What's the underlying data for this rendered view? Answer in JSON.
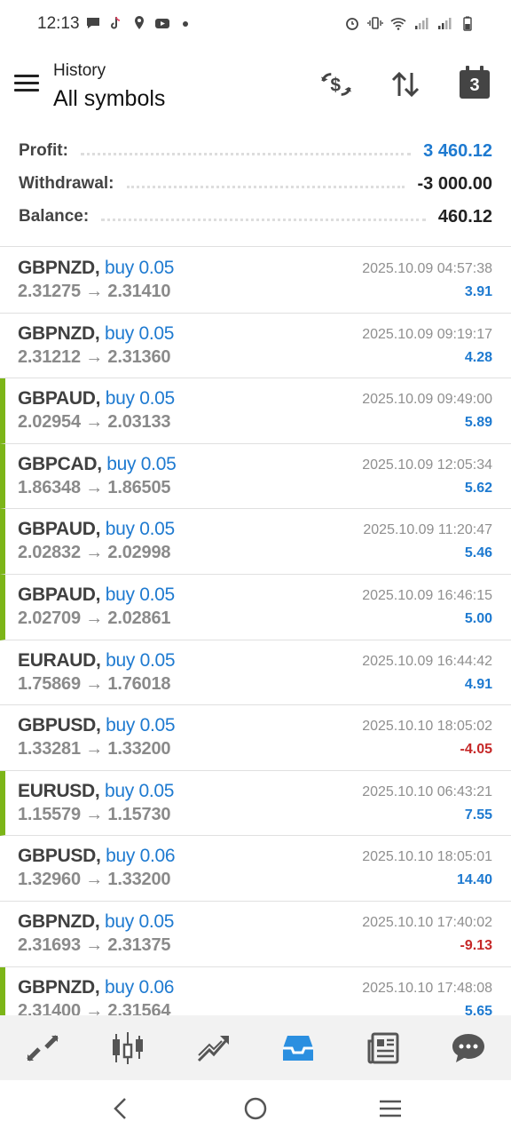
{
  "status_bar": {
    "time": "12:13",
    "left_icons": [
      "message-icon",
      "tiktok-icon",
      "location-icon",
      "youtube-icon",
      "dot-icon"
    ],
    "right_icons": [
      "alarm-icon",
      "vibrate-icon",
      "wifi-icon",
      "signal-icon",
      "signal-icon",
      "battery-icon"
    ]
  },
  "header": {
    "subtitle": "History",
    "title": "All symbols",
    "calendar_badge": "3",
    "actions": [
      "currency-exchange-icon",
      "sort-icon",
      "calendar-icon"
    ]
  },
  "summary": {
    "profit_label": "Profit:",
    "profit_value": "3 460.12",
    "withdrawal_label": "Withdrawal:",
    "withdrawal_value": "-3 000.00",
    "balance_label": "Balance:",
    "balance_value": "460.12"
  },
  "deals": [
    {
      "symbol": "GBPNZD,",
      "side": "buy 0.05",
      "prices": "2.31275 → 2.31410",
      "time": "2025.10.09 04:57:38",
      "pl": "3.91",
      "marked": false,
      "negative": false
    },
    {
      "symbol": "GBPNZD,",
      "side": "buy 0.05",
      "prices": "2.31212 → 2.31360",
      "time": "2025.10.09 09:19:17",
      "pl": "4.28",
      "marked": false,
      "negative": false
    },
    {
      "symbol": "GBPAUD,",
      "side": "buy 0.05",
      "prices": "2.02954 → 2.03133",
      "time": "2025.10.09 09:49:00",
      "pl": "5.89",
      "marked": true,
      "negative": false
    },
    {
      "symbol": "GBPCAD,",
      "side": "buy 0.05",
      "prices": "1.86348 → 1.86505",
      "time": "2025.10.09 12:05:34",
      "pl": "5.62",
      "marked": true,
      "negative": false
    },
    {
      "symbol": "GBPAUD,",
      "side": "buy 0.05",
      "prices": "2.02832 → 2.02998",
      "time": "2025.10.09 11:20:47",
      "pl": "5.46",
      "marked": true,
      "negative": false
    },
    {
      "symbol": "GBPAUD,",
      "side": "buy 0.05",
      "prices": "2.02709 → 2.02861",
      "time": "2025.10.09 16:46:15",
      "pl": "5.00",
      "marked": true,
      "negative": false
    },
    {
      "symbol": "EURAUD,",
      "side": "buy 0.05",
      "prices": "1.75869 → 1.76018",
      "time": "2025.10.09 16:44:42",
      "pl": "4.91",
      "marked": false,
      "negative": false
    },
    {
      "symbol": "GBPUSD,",
      "side": "buy 0.05",
      "prices": "1.33281 → 1.33200",
      "time": "2025.10.10 18:05:02",
      "pl": "-4.05",
      "marked": false,
      "negative": true
    },
    {
      "symbol": "EURUSD,",
      "side": "buy 0.05",
      "prices": "1.15579 → 1.15730",
      "time": "2025.10.10 06:43:21",
      "pl": "7.55",
      "marked": true,
      "negative": false
    },
    {
      "symbol": "GBPUSD,",
      "side": "buy 0.06",
      "prices": "1.32960 → 1.33200",
      "time": "2025.10.10 18:05:01",
      "pl": "14.40",
      "marked": false,
      "negative": false
    },
    {
      "symbol": "GBPNZD,",
      "side": "buy 0.05",
      "prices": "2.31693 → 2.31375",
      "time": "2025.10.10 17:40:02",
      "pl": "-9.13",
      "marked": false,
      "negative": true
    },
    {
      "symbol": "GBPNZD,",
      "side": "buy 0.06",
      "prices": "2.31400 → 2.31564",
      "time": "2025.10.10 17:48:08",
      "pl": "5.65",
      "marked": true,
      "negative": false
    }
  ],
  "bottom_nav": [
    "quotes-icon",
    "chart-icon",
    "trade-icon",
    "history-icon",
    "news-icon",
    "messages-icon"
  ],
  "system_nav": [
    "back-icon",
    "home-icon",
    "recents-icon"
  ],
  "colors": {
    "accent_blue": "#1e7ad0",
    "loss_red": "#c62828",
    "marker_green": "#7cb518",
    "active_nav": "#2b8fe0"
  }
}
